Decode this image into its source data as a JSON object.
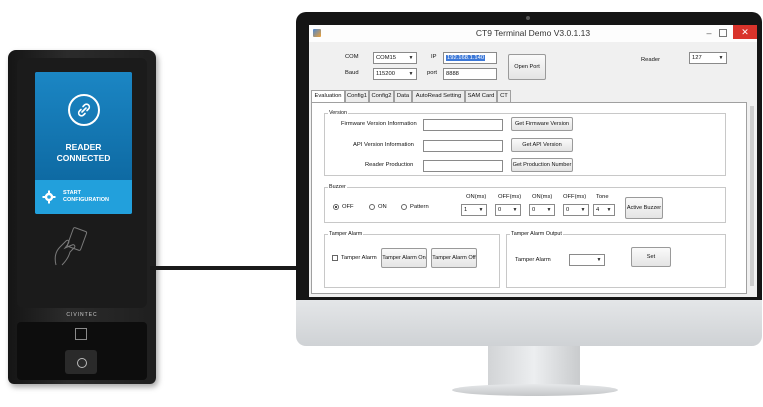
{
  "device": {
    "status_line1": "READER",
    "status_line2": "CONNECTED",
    "config_line1": "START",
    "config_line2": "CONFIGURATION",
    "brand": "CIVINTEC",
    "screen_color": "#0f6fa8",
    "accent_color": "#22a0dc"
  },
  "window": {
    "title": "CT9 Terminal Demo V3.0.1.13",
    "min_glyph": "–",
    "close_glyph": "✕"
  },
  "connection": {
    "com_label": "COM",
    "com_value": "COM15",
    "ip_label": "IP",
    "ip_value": "192.168.1.140",
    "baud_label": "Baud",
    "baud_value": "115200",
    "port_label": "port",
    "port_value": "8888",
    "open_port_label": "Open Port",
    "reader_label": "Reader",
    "reader_value": "127"
  },
  "tabs": [
    "Evaluation",
    "Config1",
    "Config2",
    "Data",
    "AutoRead Setting",
    "SAM Card",
    "CT"
  ],
  "version": {
    "group_title": "Version",
    "firmware_label": "Firmware Version Information",
    "api_label": "API Version Information",
    "production_label": "Reader Production",
    "firmware_value": "",
    "api_value": "",
    "production_value": "",
    "get_firmware_button": "Get Firmware Version",
    "get_api_button": "Get API Version",
    "get_production_button": "Get Production Number"
  },
  "buzzer": {
    "group_title": "Buzzer",
    "radio_off": "OFF",
    "radio_on": "ON",
    "radio_pattern": "Pattern",
    "col1": "ON(ms)",
    "col2": "OFF(ms)",
    "col3": "ON(ms)",
    "col4": "OFF(ms)",
    "col5": "Tone",
    "val1": "1",
    "val2": "0",
    "val3": "0",
    "val4": "0",
    "val5": "4",
    "active_button": "Active Buzzer",
    "selected": "OFF"
  },
  "tamper_alarm": {
    "group_title": "Tamper Alarm",
    "checkbox_label": "Tamper Alarm",
    "on_button": "Tamper Alarm On",
    "off_button": "Tamper Alarm Off"
  },
  "tamper_output": {
    "group_title": "Tamper Alarm Output",
    "label": "Tamper Alarm",
    "value": "",
    "set_button": "Set"
  }
}
